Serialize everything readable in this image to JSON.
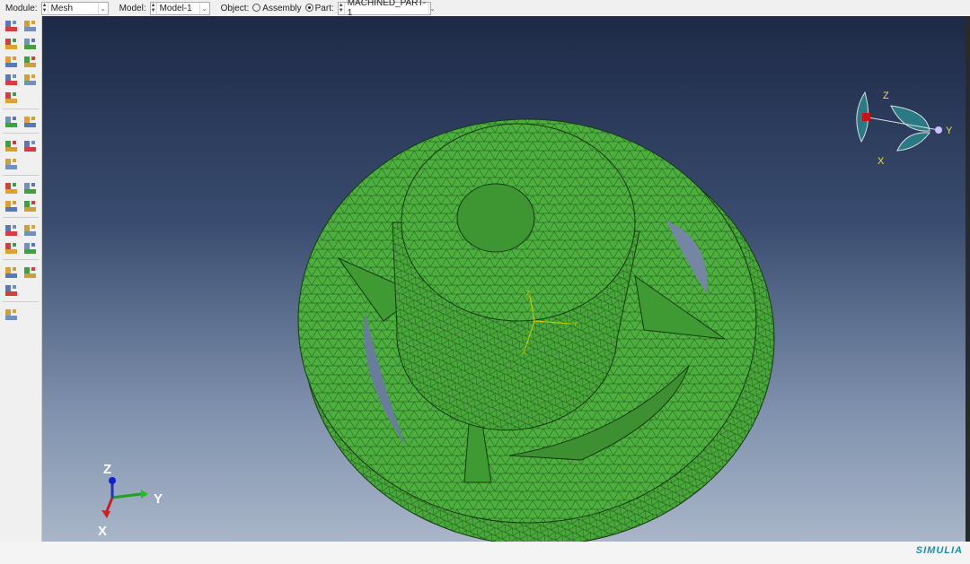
{
  "topbar": {
    "module_label": "Module:",
    "module_value": "Mesh",
    "model_label": "Model:",
    "model_value": "Model-1",
    "object_label": "Object:",
    "assembly_label": "Assembly",
    "part_label": "Part:",
    "part_value": "MACHINED_PART-1",
    "selected_object": "Part"
  },
  "toolbox": {
    "icons": [
      "seed-part-icon",
      "seed-edge-icon",
      "mesh-controls-icon",
      "element-type-icon",
      "mesh-part-icon",
      "delete-mesh-icon",
      "assign-stack-icon",
      "verify-mesh-icon",
      "mesh-region-icon",
      "query-icon",
      "mesh-stats-icon",
      "edit-mesh-icon",
      "offset-mesh-icon",
      "mesh-pencil-icon",
      "partition-edge-icon",
      "partition-face-icon",
      "partition-cell-icon",
      "partition-cut-icon",
      "datum-point-icon",
      "datum-axis-icon",
      "datum-plane-icon",
      "datum-csys-icon",
      "virtual-topology-icon",
      "repair-geometry-icon",
      "edit-geometry-icon",
      "tools-icon"
    ]
  },
  "viewport": {
    "triad": {
      "x": "X",
      "y": "Y",
      "z": "Z"
    },
    "view_cube": {
      "x": "X",
      "y": "Y",
      "z": "Z"
    },
    "csys": {
      "x": "X",
      "y": "Y",
      "z": "Z"
    },
    "mesh_color": "#4caf3e"
  },
  "statusbar": {
    "logo": "SIMULIA"
  }
}
